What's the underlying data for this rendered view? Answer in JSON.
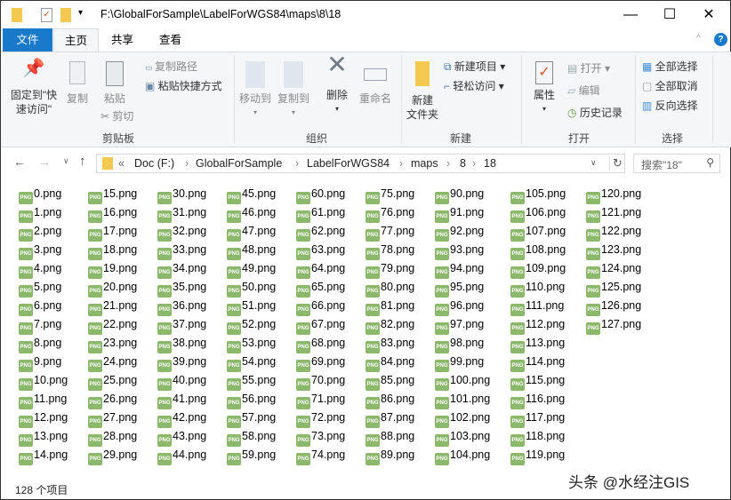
{
  "window": {
    "title": "F:\\GlobalForSample\\LabelForWGS84\\maps\\8\\18",
    "minimize": "—",
    "maximize": "☐",
    "close": "✕"
  },
  "tabs": [
    "文件",
    "主页",
    "共享",
    "查看"
  ],
  "ribbon": {
    "clipboard": {
      "pin": "固定到\"快速访问\"",
      "pin1": "固定到\"快",
      "pin2": "速访问\"",
      "copy": "复制",
      "paste": "粘贴",
      "copy_path": "复制路径",
      "paste_shortcut": "粘贴快捷方式",
      "cut": "剪切",
      "label": "剪贴板"
    },
    "organize": {
      "move_to": "移动到",
      "copy_to": "复制到",
      "delete": "删除",
      "rename": "重命名",
      "label": "组织"
    },
    "new": {
      "new_folder1": "新建",
      "new_folder2": "文件夹",
      "new_item": "新建项目",
      "easy_access": "轻松访问",
      "label": "新建"
    },
    "open": {
      "properties": "属性",
      "open": "打开",
      "edit": "编辑",
      "history": "历史记录",
      "label": "打开"
    },
    "select": {
      "select_all": "全部选择",
      "select_none": "全部取消",
      "invert": "反向选择",
      "label": "选择"
    }
  },
  "address": {
    "crumbs": [
      "Doc (F:)",
      "GlobalForSample",
      "LabelForWGS84",
      "maps",
      "8",
      "18"
    ],
    "prefix": "«",
    "search_placeholder": "搜索\"18\""
  },
  "files": [
    "0.png",
    "1.png",
    "2.png",
    "3.png",
    "4.png",
    "5.png",
    "6.png",
    "7.png",
    "8.png",
    "9.png",
    "10.png",
    "11.png",
    "12.png",
    "13.png",
    "14.png",
    "15.png",
    "16.png",
    "17.png",
    "18.png",
    "19.png",
    "20.png",
    "21.png",
    "22.png",
    "23.png",
    "24.png",
    "25.png",
    "26.png",
    "27.png",
    "28.png",
    "29.png",
    "30.png",
    "31.png",
    "32.png",
    "33.png",
    "34.png",
    "35.png",
    "36.png",
    "37.png",
    "38.png",
    "39.png",
    "40.png",
    "41.png",
    "42.png",
    "43.png",
    "44.png",
    "45.png",
    "46.png",
    "47.png",
    "48.png",
    "49.png",
    "50.png",
    "51.png",
    "52.png",
    "53.png",
    "54.png",
    "55.png",
    "56.png",
    "57.png",
    "58.png",
    "59.png",
    "60.png",
    "61.png",
    "62.png",
    "63.png",
    "64.png",
    "65.png",
    "66.png",
    "67.png",
    "68.png",
    "69.png",
    "70.png",
    "71.png",
    "72.png",
    "73.png",
    "74.png",
    "75.png",
    "76.png",
    "77.png",
    "78.png",
    "79.png",
    "80.png",
    "81.png",
    "82.png",
    "83.png",
    "84.png",
    "85.png",
    "86.png",
    "87.png",
    "88.png",
    "89.png",
    "90.png",
    "91.png",
    "92.png",
    "93.png",
    "94.png",
    "95.png",
    "96.png",
    "97.png",
    "98.png",
    "99.png",
    "100.png",
    "101.png",
    "102.png",
    "103.png",
    "104.png",
    "105.png",
    "106.png",
    "107.png",
    "108.png",
    "109.png",
    "110.png",
    "111.png",
    "112.png",
    "113.png",
    "114.png",
    "115.png",
    "116.png",
    "117.png",
    "118.png",
    "119.png",
    "120.png",
    "121.png",
    "122.png",
    "123.png",
    "124.png",
    "125.png",
    "126.png",
    "127.png"
  ],
  "file_icon_text": "PNG",
  "status": "128 个项目",
  "watermark": "头条 @水经注GIS"
}
